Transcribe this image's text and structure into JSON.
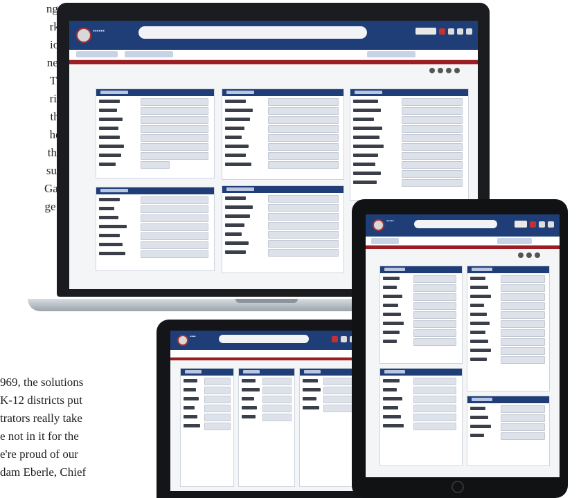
{
  "article": {
    "top_lines": [
      "nges",
      "rket",
      "ion.",
      "neur",
      "The",
      "rive",
      "that",
      "heir",
      "than",
      "such",
      "Gard",
      "ge in"
    ],
    "bottom_lines": [
      "969, the solutions",
      "K-12 districts put",
      "trators really take",
      "e not in it for the",
      "e're proud of our",
      "dam Eberle, Chief"
    ]
  },
  "colors": {
    "header_blue": "#1f3e78",
    "accent_red": "#9c1d24",
    "device_black": "#1a1c1f",
    "screen_bg": "#f4f5f7"
  },
  "icons": {
    "toolbar": [
      "app-logo",
      "user-menu-icon",
      "printer-icon",
      "home-icon",
      "settings-icon",
      "help-icon"
    ]
  }
}
